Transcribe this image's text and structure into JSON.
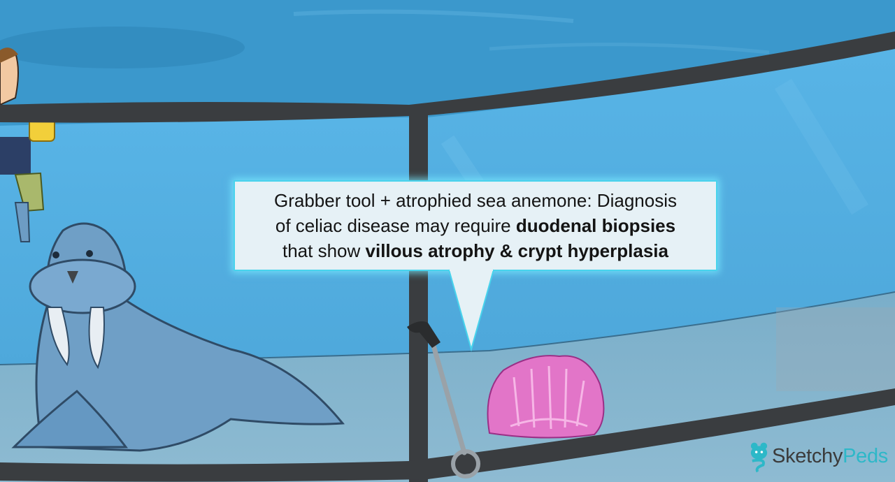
{
  "callout": {
    "lines": [
      [
        {
          "text": "Grabber tool + atrophied sea anemone: Diagnosis",
          "bold": false
        }
      ],
      [
        {
          "text": "of celiac disease may require ",
          "bold": false
        },
        {
          "text": "duodenal biopsies",
          "bold": true
        }
      ],
      [
        {
          "text": "that show ",
          "bold": false
        },
        {
          "text": "villous atrophy & crypt hyperplasia",
          "bold": true
        }
      ]
    ]
  },
  "logo": {
    "word1": "Sketchy",
    "word2": "Peds"
  },
  "colors": {
    "water": "#3d9bd0",
    "glass": "#5bb5e6",
    "railing": "#3a3d40",
    "walrus": "#6f9fc6",
    "anemone": "#e275c8",
    "callout_border": "#48d3ec",
    "brand_accent": "#2db8c8"
  },
  "icons": [
    "sketchy-bear-logo-icon"
  ]
}
